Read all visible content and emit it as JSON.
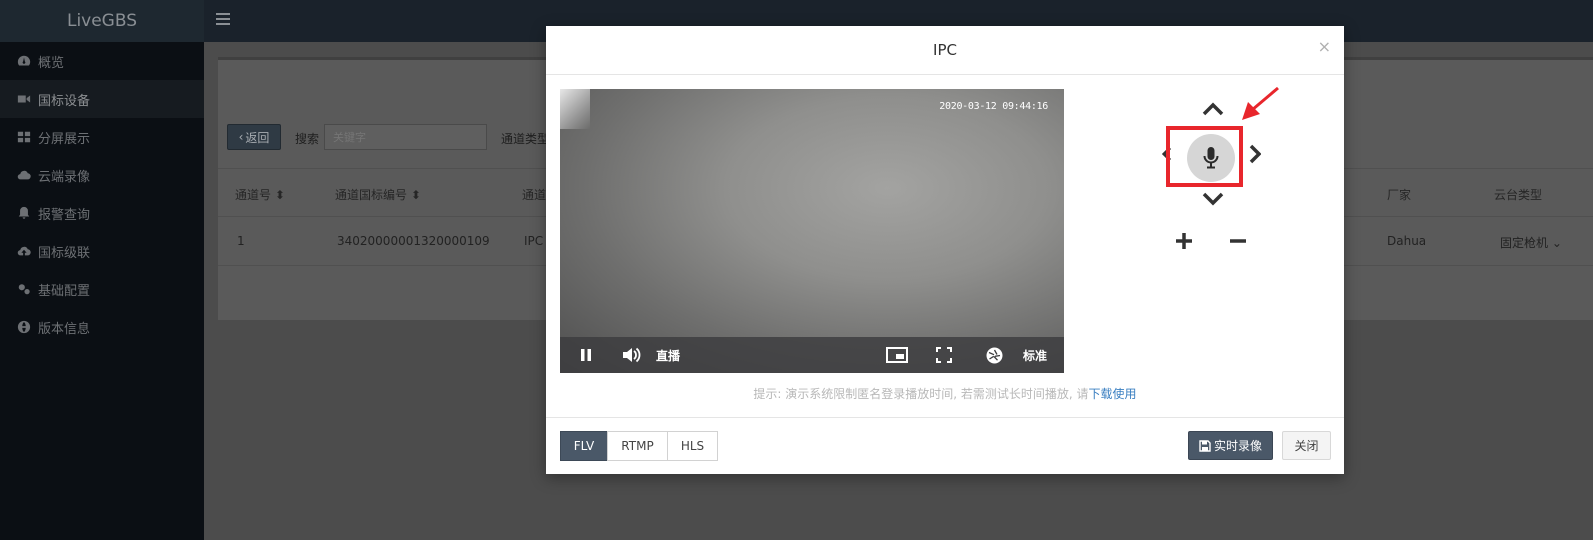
{
  "app": {
    "brand": "LiveGBS"
  },
  "sidebar": {
    "items": [
      {
        "label": "概览",
        "icon": "dashboard-icon"
      },
      {
        "label": "国标设备",
        "icon": "video-camera-icon"
      },
      {
        "label": "分屏展示",
        "icon": "grid-icon"
      },
      {
        "label": "云端录像",
        "icon": "cloud-icon"
      },
      {
        "label": "报警查询",
        "icon": "bell-icon"
      },
      {
        "label": "国标级联",
        "icon": "cloud-upload-icon"
      },
      {
        "label": "基础配置",
        "icon": "cogs-icon"
      },
      {
        "label": "版本信息",
        "icon": "globe-icon"
      }
    ]
  },
  "toolbar": {
    "back_label": "返回",
    "search_label": "搜索",
    "search_placeholder": "关键字",
    "filter_label": "通道类型"
  },
  "table": {
    "headers": [
      "通道号",
      "通道国标编号",
      "通道",
      "厂家",
      "云台类型"
    ],
    "row": {
      "channel_no": "1",
      "gb_id": "34020000001320000109",
      "type": "IPC",
      "vendor": "Dahua",
      "ptz_type": "固定枪机"
    }
  },
  "modal": {
    "title": "IPC",
    "close_glyph": "×",
    "video": {
      "timestamp": "2020-03-12 09:44:16",
      "live_label": "直播",
      "quality_label": "标准"
    },
    "hint_prefix": "提示: 演示系统限制匿名登录播放时间, 若需测试长时间播放, 请",
    "hint_link": "下载使用",
    "protocols": [
      "FLV",
      "RTMP",
      "HLS"
    ],
    "active_protocol": "FLV",
    "record_label": "实时录像",
    "close_label": "关闭"
  },
  "colors": {
    "accent": "#4a5868",
    "highlight": "#e8262c",
    "link": "#3a7fc1"
  }
}
